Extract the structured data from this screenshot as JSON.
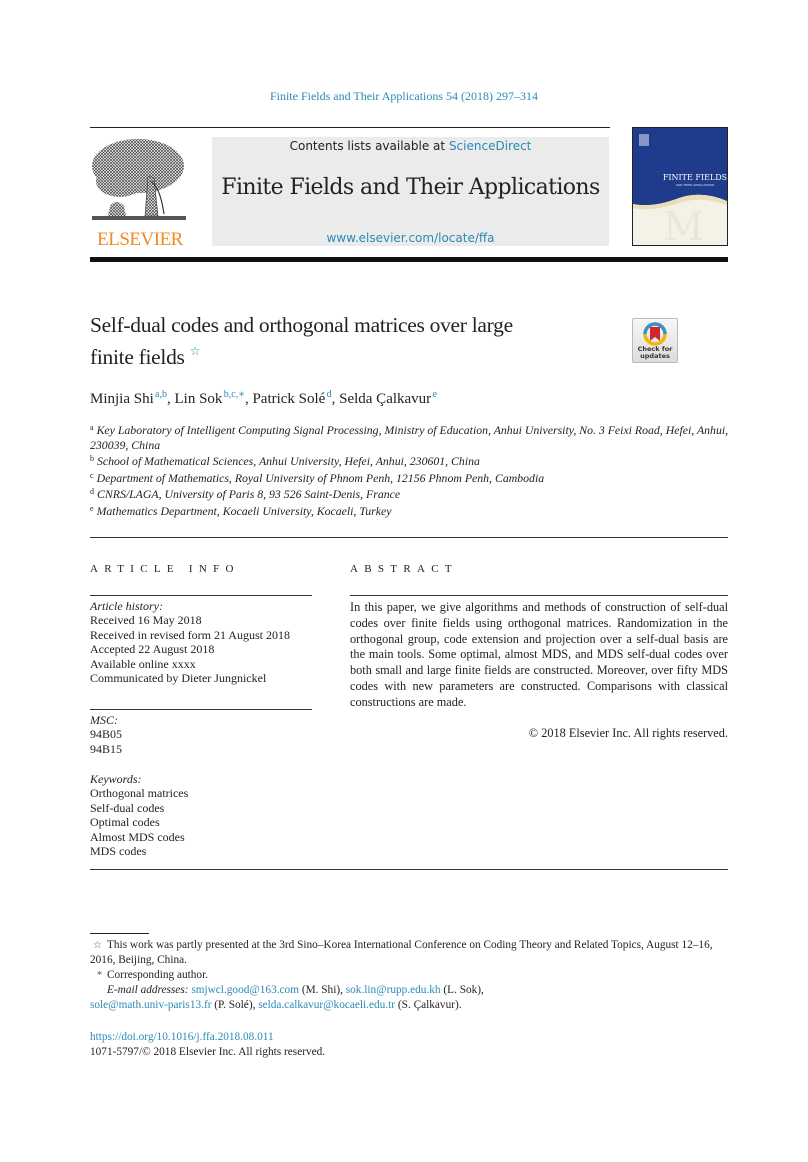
{
  "running_head": "Finite Fields and Their Applications 54 (2018) 297–314",
  "masthead": {
    "publisher_logo_text": "ELSEVIER",
    "contents_prefix": "Contents lists available at ",
    "contents_link": "ScienceDirect",
    "journal_name": "Finite Fields and Their Applications",
    "journal_url": "www.elsevier.com/locate/ffa",
    "cover_title": "FINITE FIELDS",
    "cover_subtitle": "AND THEIR APPLICATIONS"
  },
  "article": {
    "title_line1": "Self-dual codes and orthogonal matrices over large",
    "title_line2": "finite fields",
    "title_footnote_mark": "☆",
    "check_updates_line1": "Check for",
    "check_updates_line2": "updates",
    "authors": [
      {
        "name": "Minjia Shi",
        "sup": "a,b",
        "sep": ", "
      },
      {
        "name": "Lin Sok",
        "sup": "b,c,∗",
        "sep": ", "
      },
      {
        "name": "Patrick Solé",
        "sup": "d",
        "sep": ", "
      },
      {
        "name": "Selda Çalkavur",
        "sup": "e",
        "sep": ""
      }
    ],
    "affiliations": [
      {
        "key": "a",
        "text": "Key Laboratory of Intelligent Computing Signal Processing, Ministry of Education, Anhui University, No. 3 Feixi Road, Hefei, Anhui, 230039, China"
      },
      {
        "key": "b",
        "text": "School of Mathematical Sciences, Anhui University, Hefei, Anhui, 230601, China"
      },
      {
        "key": "c",
        "text": "Department of Mathematics, Royal University of Phnom Penh, 12156 Phnom Penh, Cambodia"
      },
      {
        "key": "d",
        "text": "CNRS/LAGA, University of Paris 8, 93 526 Saint-Denis, France"
      },
      {
        "key": "e",
        "text": "Mathematics Department, Kocaeli University, Kocaeli, Turkey"
      }
    ]
  },
  "article_info": {
    "heading": "ARTICLE INFO",
    "history_label": "Article history:",
    "history": [
      "Received 16 May 2018",
      "Received in revised form 21 August 2018",
      "Accepted 22 August 2018",
      "Available online xxxx",
      "Communicated by Dieter Jungnickel"
    ],
    "msc_label": "MSC:",
    "msc": [
      "94B05",
      "94B15"
    ],
    "keywords_label": "Keywords:",
    "keywords": [
      "Orthogonal matrices",
      "Self-dual codes",
      "Optimal codes",
      "Almost MDS codes",
      "MDS codes"
    ]
  },
  "abstract": {
    "heading": "ABSTRACT",
    "text": "In this paper, we give algorithms and methods of construction of self-dual codes over finite fields using orthogonal matrices. Randomization in the orthogonal group, code extension and projection over a self-dual basis are the main tools. Some optimal, almost MDS, and MDS self-dual codes over both small and large finite fields are constructed. Moreover, over fifty MDS codes with new parameters are constructed. Comparisons with classical constructions are made.",
    "copyright": "© 2018 Elsevier Inc. All rights reserved."
  },
  "footnotes": {
    "star_mark": "☆",
    "star_text": "This work was partly presented at the 3rd Sino–Korea International Conference on Coding Theory and Related Topics, August 12–16, 2016, Beijing, China.",
    "corr_mark": "*",
    "corr_text": "Corresponding author.",
    "email_label": "E-mail addresses:",
    "emails": [
      {
        "address": "smjwcl.good@163.com",
        "who": " (M. Shi), "
      },
      {
        "address": "sok.lin@rupp.edu.kh",
        "who": " (L. Sok), "
      },
      {
        "address": "sole@math.univ-paris13.fr",
        "who": " (P. Solé), "
      },
      {
        "address": "selda.calkavur@kocaeli.edu.tr",
        "who": " (S. Çalkavur)."
      }
    ]
  },
  "doi": "https://doi.org/10.1016/j.ffa.2018.08.011",
  "issn_line": "1071-5797/© 2018 Elsevier Inc. All rights reserved.",
  "colors": {
    "link": "#2a8ab8",
    "elsevier_orange": "#f08a24",
    "masthead_bg": "#ebebeb",
    "cover_blue": "#1f3b8c"
  }
}
